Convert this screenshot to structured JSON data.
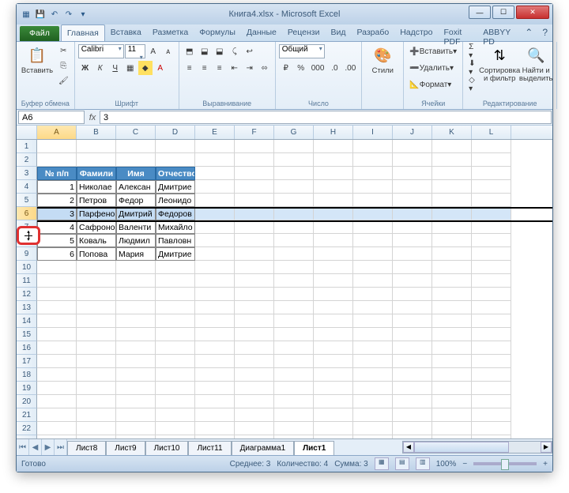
{
  "window": {
    "title": "Книга4.xlsx - Microsoft Excel"
  },
  "qat": {
    "save": "💾",
    "undo": "↶",
    "redo": "↷"
  },
  "tabs": {
    "file": "Файл",
    "home": "Главная",
    "insert": "Вставка",
    "layout": "Разметка",
    "formulas": "Формулы",
    "data": "Данные",
    "review": "Рецензи",
    "view": "Вид",
    "dev": "Разрабо",
    "addins": "Надстро",
    "foxit": "Foxit PDF",
    "abbyy": "ABBYY PD"
  },
  "ribbon": {
    "paste": "Вставить",
    "clipboard": "Буфер обмена",
    "font": "Calibri",
    "size": "11",
    "font_group": "Шрифт",
    "align_group": "Выравнивание",
    "numfmt": "Общий",
    "num_group": "Число",
    "styles": "Стили",
    "insert": "Вставить",
    "delete": "Удалить",
    "format": "Формат",
    "cells_group": "Ячейки",
    "sort": "Сортировка и фильтр",
    "find": "Найти и выделить",
    "edit_group": "Редактирование"
  },
  "namebox": "A6",
  "formula": "3",
  "columns": [
    "A",
    "B",
    "C",
    "D",
    "E",
    "F",
    "G",
    "H",
    "I",
    "J",
    "K",
    "L"
  ],
  "headers": {
    "a": "№ п/п",
    "b": "Фамили",
    "c": "Имя",
    "d": "Отчество"
  },
  "rows": [
    {
      "n": "1",
      "a": "1",
      "b": "Николае",
      "c": "Алексан",
      "d": "Дмитрие"
    },
    {
      "n": "2",
      "a": "2",
      "b": "Петров",
      "c": "Федор",
      "d": "Леонидо"
    },
    {
      "n": "3",
      "a": "3",
      "b": "Парфено",
      "c": "Дмитрий",
      "d": "Федоров"
    },
    {
      "n": "4",
      "a": "4",
      "b": "Сафроно",
      "c": "Валенти",
      "d": "Михайло"
    },
    {
      "n": "5",
      "a": "5",
      "b": "Коваль",
      "c": "Людмил",
      "d": "Павловн"
    },
    {
      "n": "6",
      "a": "6",
      "b": "Попова",
      "c": "Мария",
      "d": "Дмитрие"
    }
  ],
  "sheets": {
    "s1": "Лист8",
    "s2": "Лист9",
    "s3": "Лист10",
    "s4": "Лист11",
    "s5": "Диаграмма1",
    "s6": "Лист1"
  },
  "status": {
    "ready": "Готово",
    "avg": "Среднее: 3",
    "count": "Количество: 4",
    "sum": "Сумма: 3",
    "zoom": "100%"
  }
}
